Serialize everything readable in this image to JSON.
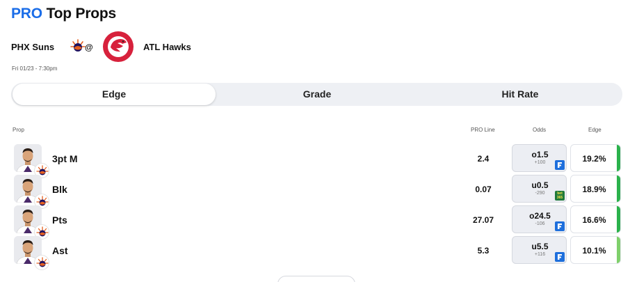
{
  "header": {
    "pro": "PRO",
    "title": "Top Props"
  },
  "matchup": {
    "home_team": "PHX Suns",
    "at": "@",
    "away_team": "ATL Hawks",
    "datetime": "Fri 01/23 - 7:30pm"
  },
  "tabs": [
    {
      "label": "Edge",
      "active": true
    },
    {
      "label": "Grade",
      "active": false
    },
    {
      "label": "Hit Rate",
      "active": false
    }
  ],
  "columns": {
    "prop": "Prop",
    "pro_line": "PRO Line",
    "odds": "Odds",
    "edge": "Edge"
  },
  "rows": [
    {
      "stat": "3pt M",
      "line": "2.4",
      "odds": "o1.5",
      "price": "+100",
      "book": "fanduel-icon",
      "edge": "19.2%",
      "edge_color": "#2bb24c"
    },
    {
      "stat": "Blk",
      "line": "0.07",
      "odds": "u0.5",
      "price": "-290",
      "book": "bet365-icon",
      "book_label": "bet 365",
      "edge": "18.9%",
      "edge_color": "#2bb24c"
    },
    {
      "stat": "Pts",
      "line": "27.07",
      "odds": "o24.5",
      "price": "-106",
      "book": "fanduel-icon",
      "edge": "16.6%",
      "edge_color": "#2bb24c"
    },
    {
      "stat": "Ast",
      "line": "5.3",
      "odds": "u5.5",
      "price": "+116",
      "book": "fanduel-icon",
      "edge": "10.1%",
      "edge_color": "#7fd06b"
    }
  ],
  "colors": {
    "pro_blue": "#1a6de8",
    "edge_green": "#2bb24c",
    "edge_light_green": "#7fd06b",
    "fanduel_blue": "#1e6fdc",
    "bet365_green": "#1f7a3c"
  }
}
